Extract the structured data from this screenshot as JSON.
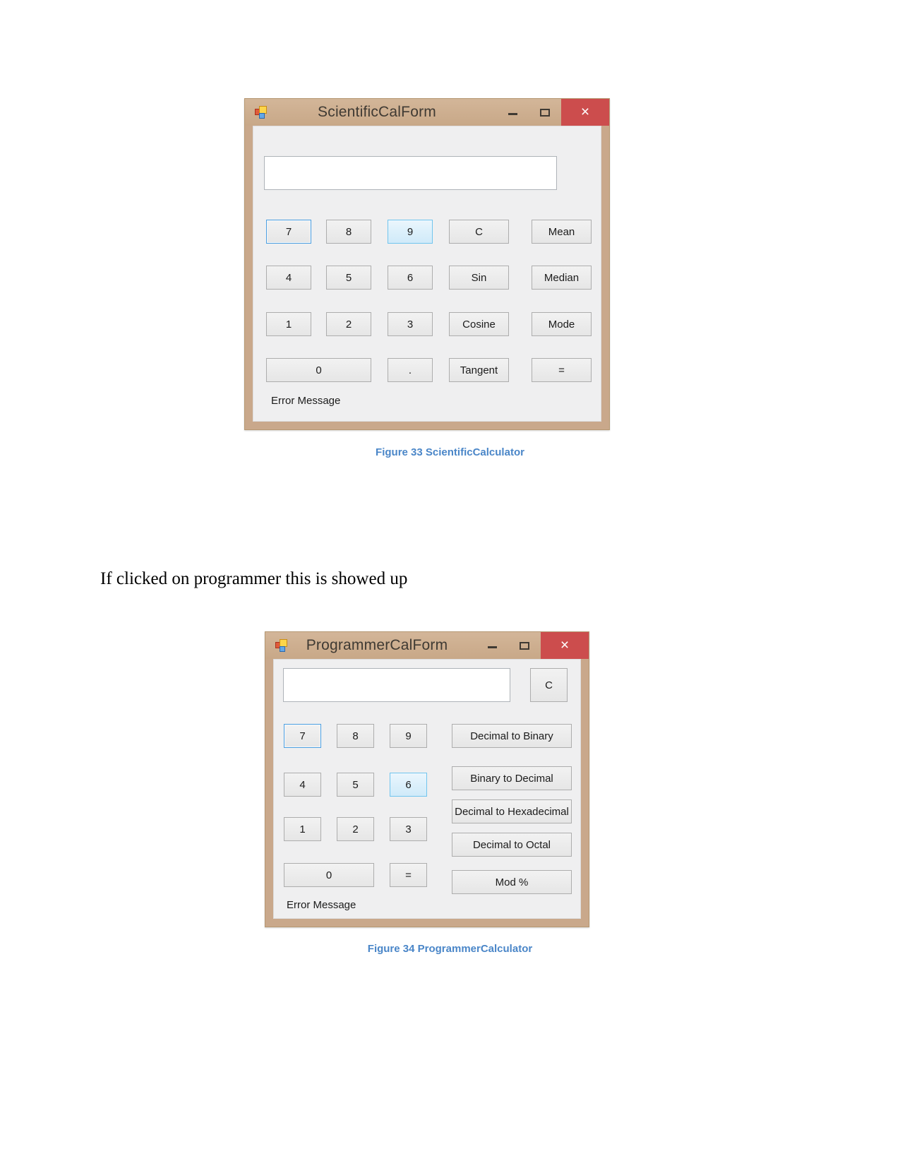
{
  "document": {
    "paragraph": "If clicked on programmer this is showed up",
    "caption_1": "Figure 33 ScientificCalculator",
    "caption_2": "Figure 34 ProgrammerCalculator"
  },
  "colors": {
    "titlebar": "#cdae8f",
    "close_button": "#cc4d4d",
    "client_background": "#efeff0",
    "focus_border": "#4d9fe0",
    "hover_fill": "#dcf0fb",
    "caption_text": "#4a86c8"
  },
  "scientific_window": {
    "title": "ScientificCalForm",
    "icon": "winforms-app-icon",
    "window_controls": {
      "minimize": "minimize-icon",
      "maximize": "maximize-icon",
      "close": "×"
    },
    "display": {
      "value": "",
      "placeholder": ""
    },
    "error_label": "Error Message",
    "buttons": [
      {
        "label": "7",
        "state": "focused"
      },
      {
        "label": "8",
        "state": "normal"
      },
      {
        "label": "9",
        "state": "hover"
      },
      {
        "label": "C",
        "state": "normal"
      },
      {
        "label": "Mean",
        "state": "normal"
      },
      {
        "label": "4",
        "state": "normal"
      },
      {
        "label": "5",
        "state": "normal"
      },
      {
        "label": "6",
        "state": "normal"
      },
      {
        "label": "Sin",
        "state": "normal"
      },
      {
        "label": "Median",
        "state": "normal"
      },
      {
        "label": "1",
        "state": "normal"
      },
      {
        "label": "2",
        "state": "normal"
      },
      {
        "label": "3",
        "state": "normal"
      },
      {
        "label": "Cosine",
        "state": "normal"
      },
      {
        "label": "Mode",
        "state": "normal"
      },
      {
        "label": "0",
        "state": "normal"
      },
      {
        "label": ".",
        "state": "normal"
      },
      {
        "label": "Tangent",
        "state": "normal"
      },
      {
        "label": "=",
        "state": "normal"
      }
    ]
  },
  "programmer_window": {
    "title": "ProgrammerCalForm",
    "icon": "winforms-app-icon",
    "window_controls": {
      "minimize": "minimize-icon",
      "maximize": "maximize-icon",
      "close": "×"
    },
    "display": {
      "value": "",
      "placeholder": ""
    },
    "clear_button": "C",
    "error_label": "Error Message",
    "digit_buttons": [
      {
        "label": "7",
        "state": "focused"
      },
      {
        "label": "8",
        "state": "normal"
      },
      {
        "label": "9",
        "state": "normal"
      },
      {
        "label": "4",
        "state": "normal"
      },
      {
        "label": "5",
        "state": "normal"
      },
      {
        "label": "6",
        "state": "hover"
      },
      {
        "label": "1",
        "state": "normal"
      },
      {
        "label": "2",
        "state": "normal"
      },
      {
        "label": "3",
        "state": "normal"
      },
      {
        "label": "0",
        "state": "normal"
      },
      {
        "label": "=",
        "state": "normal"
      }
    ],
    "function_buttons": [
      {
        "label": "Decimal to Binary"
      },
      {
        "label": "Binary to Decimal"
      },
      {
        "label": "Decimal to Hexadecimal"
      },
      {
        "label": "Decimal to Octal"
      },
      {
        "label": "Mod %"
      }
    ]
  }
}
